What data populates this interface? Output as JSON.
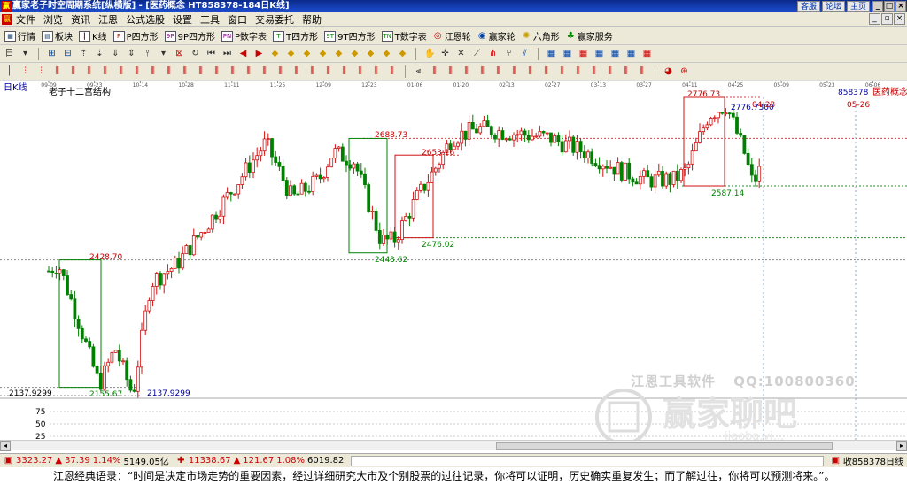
{
  "window": {
    "title": "赢家老子时空周期系统[纵横版] - [医药概念  HT858378-184日K线]",
    "links": [
      "客服",
      "论坛",
      "主页"
    ],
    "controls": [
      "_",
      "□",
      "×"
    ]
  },
  "menu": [
    "文件",
    "浏览",
    "资讯",
    "江恩",
    "公式选股",
    "设置",
    "工具",
    "窗口",
    "交易委托",
    "帮助"
  ],
  "toolbar1": [
    "行情",
    "板块",
    "K线",
    "P四方形",
    "9P四方形",
    "P数字表",
    "T四方形",
    "9T四方形",
    "T数字表",
    "江恩轮",
    "赢家轮",
    "六角形",
    "赢家服务"
  ],
  "chart": {
    "period_label": "日K线",
    "structure_title": "老子十二宫结构",
    "code_label": "858378",
    "name_label": "医药概念",
    "date_marker": "05-26",
    "date_marker2": "04-28",
    "date_ticks": [
      "09-09",
      "09-23",
      "10-14",
      "10-28",
      "11-11",
      "11-25",
      "12-09",
      "12-23",
      "01-06",
      "01-20",
      "02-13",
      "02-27",
      "03-13",
      "03-27",
      "04-11",
      "04-25",
      "05-09",
      "05-23",
      "06-06"
    ],
    "y_left_label": "2137.9299",
    "price_labels": {
      "p2428": "2428.70",
      "p2155": "2155.67",
      "p2137": "2137.9299",
      "p2688": "2688.73",
      "p2443": "2443.62",
      "p2653": "2653.16",
      "p2476": "2476.02",
      "p2776": "2776.73",
      "p2776b": "2776.7300",
      "p2587": "2587.14"
    },
    "indicator_ticks": [
      "75",
      "50",
      "25"
    ]
  },
  "chart_data": {
    "type": "candlestick",
    "title": "老子十二宫结构",
    "xlabel": "",
    "ylabel": "",
    "x_ticks": [
      "09-09",
      "09-23",
      "10-14",
      "10-28",
      "11-11",
      "11-25",
      "12-09",
      "12-23",
      "01-06",
      "01-20",
      "02-13",
      "02-27",
      "03-13",
      "03-27",
      "04-11",
      "04-25",
      "05-09",
      "05-23",
      "06-06"
    ],
    "key_levels": [
      2428.7,
      2155.67,
      2137.9299,
      2688.73,
      2443.62,
      2653.16,
      2476.02,
      2776.73,
      2587.14
    ],
    "ylim": [
      2137.9299,
      2776.73
    ],
    "grid": false,
    "indicator_axis": [
      75,
      50,
      25
    ]
  },
  "statusbar": {
    "idx1": "3323.27",
    "idx1_chg": "37.39",
    "idx1_pct": "1.14%",
    "idx1_amt": "5149.05亿",
    "idx2": "11338.67",
    "idx2_chg": "121.67",
    "idx2_pct": "1.08%",
    "idx2_amt": "6019.82",
    "right": "收858378日线"
  },
  "quote": "江恩经典语录：“时间是决定市场走势的重要因素，经过详细研究大市及个别股票的过往记录，你将可以证明，历史确实重复发生；而了解过往，你将可以预测将来。”。",
  "watermark": {
    "company": "江恩工具软件",
    "qq": "QQ:100800360",
    "brand": "赢家聊吧",
    "url": "jiaoba.yi..."
  },
  "colors": {
    "up": "#d01010",
    "down": "#008000",
    "dotted_red": "#d04040",
    "dotted_green": "#2a8a2a",
    "title_bg": "#0a2a8a",
    "label_blue": "#0000a0"
  }
}
